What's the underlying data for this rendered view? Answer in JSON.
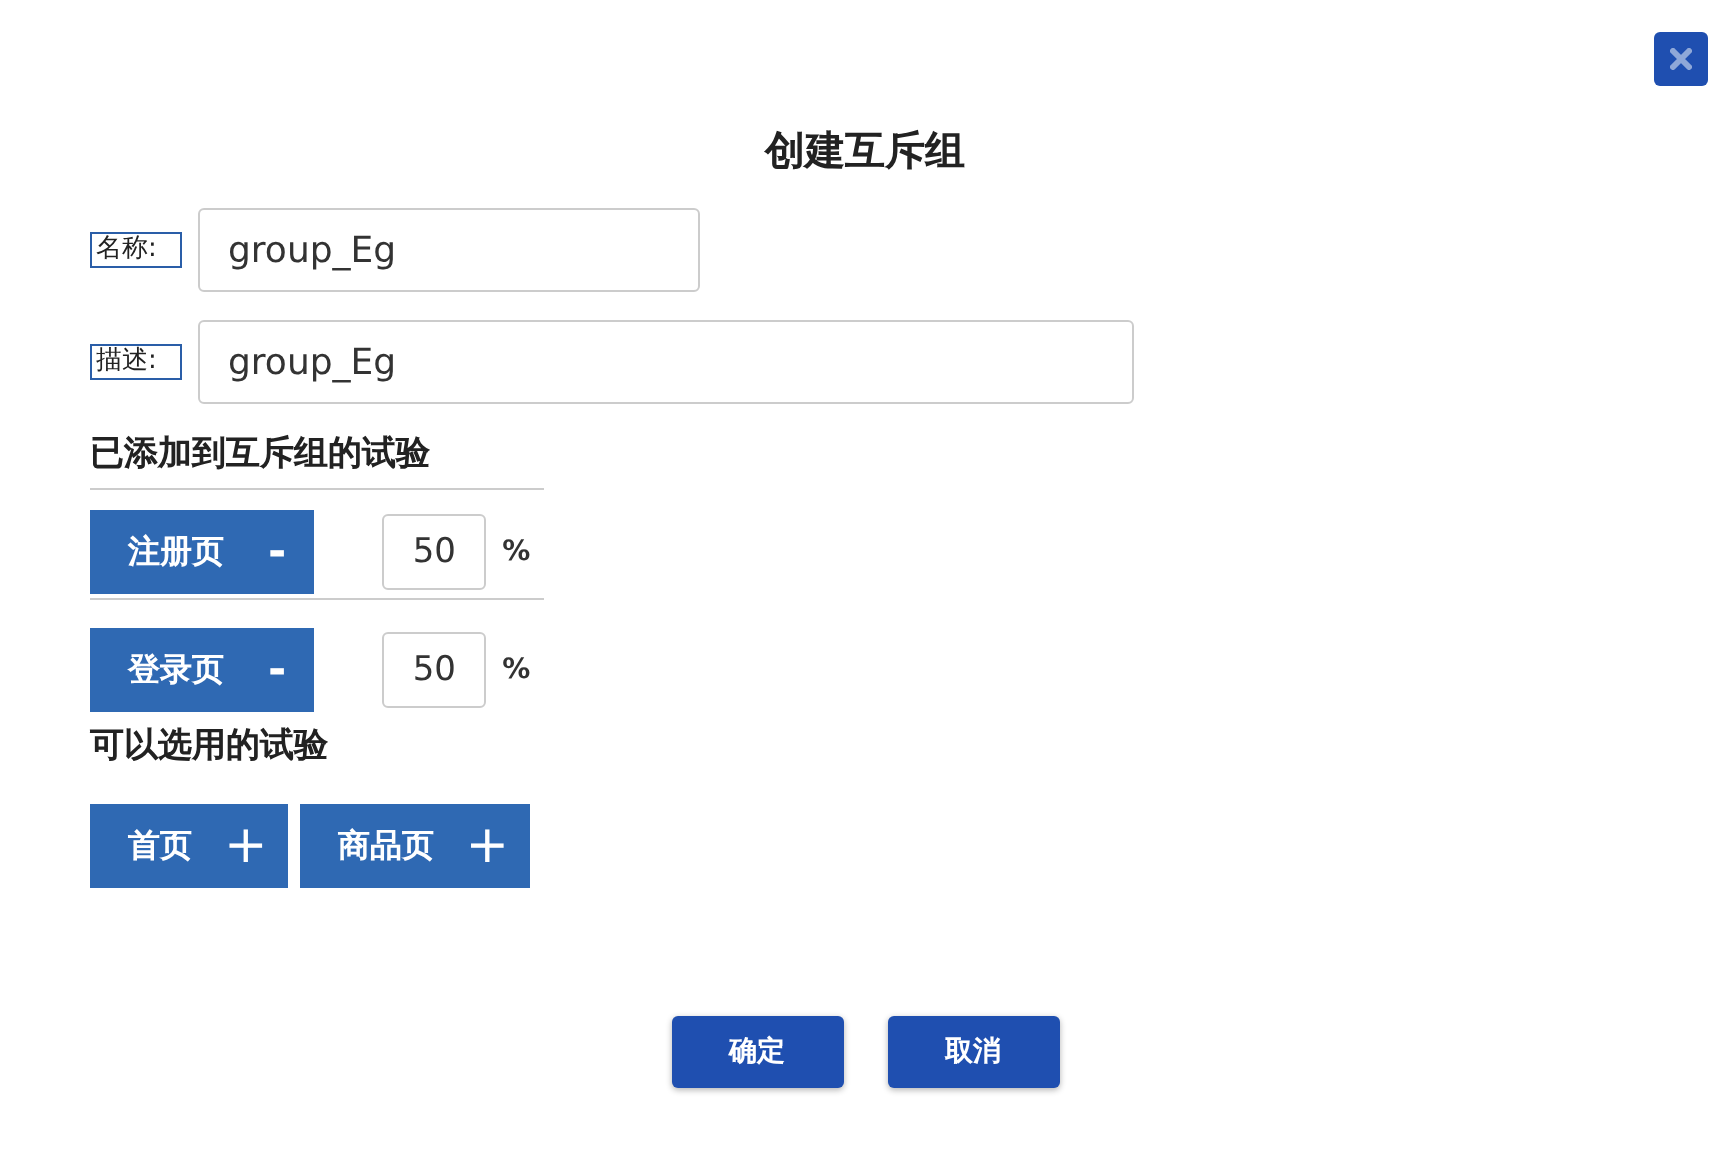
{
  "dialog": {
    "title": "创建互斥组"
  },
  "fields": [
    {
      "label": "名称:",
      "value": "group_Eg"
    },
    {
      "label": "描述:",
      "value": "group_Eg"
    }
  ],
  "added": {
    "heading": "已添加到互斥组的试验",
    "items": [
      {
        "label": "注册页",
        "sign": "-",
        "percent": "50",
        "unit": "%"
      },
      {
        "label": "登录页",
        "sign": "-",
        "percent": "50",
        "unit": "%"
      }
    ]
  },
  "available": {
    "heading": "可以选用的试验",
    "items": [
      {
        "label": "首页",
        "sign": "+"
      },
      {
        "label": "商品页",
        "sign": "+"
      }
    ]
  },
  "buttons": [
    "确定",
    "取消"
  ]
}
